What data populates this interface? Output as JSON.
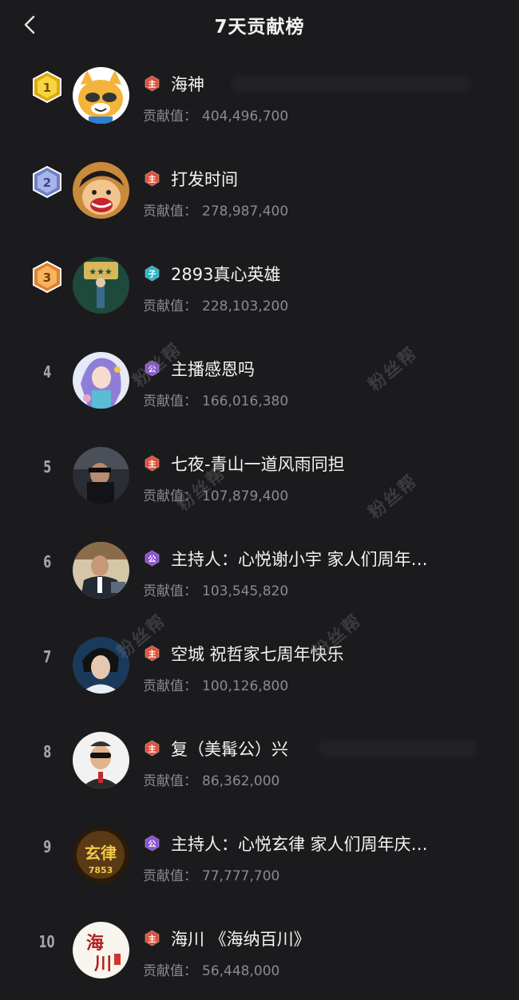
{
  "header": {
    "title": "7天贡献榜"
  },
  "contrib_label": "贡献值：",
  "watermark": "粉丝帮",
  "colors": {
    "badge_red": "#e0533a",
    "badge_cyan": "#2bb6c7",
    "badge_purple": "#8a52d6",
    "gold": "#f2c21c",
    "silver": "#8e9bd8",
    "bronze": "#f09a3a"
  },
  "entries": [
    {
      "rank": "1",
      "medal": "gold",
      "badge": "主",
      "badge_color": "red",
      "name": "海神",
      "value": "404,496,700",
      "avatar_icon": "raccoon-mascot-icon"
    },
    {
      "rank": "2",
      "medal": "silver",
      "badge": "主",
      "badge_color": "red",
      "name": "打发时间",
      "value": "278,987,400",
      "avatar_icon": "anime-boy-icon"
    },
    {
      "rank": "3",
      "medal": "bronze",
      "badge": "子",
      "badge_color": "cyan",
      "name": "2893真心英雄",
      "value": "228,103,200",
      "avatar_icon": "poster-icon"
    },
    {
      "rank": "4",
      "medal": "",
      "badge": "公",
      "badge_color": "purple",
      "name": "主播感恩吗",
      "value": "166,016,380",
      "avatar_icon": "anime-girl-icon"
    },
    {
      "rank": "5",
      "medal": "",
      "badge": "主",
      "badge_color": "red",
      "name": "七夜-青山一道风雨同担",
      "value": "107,879,400",
      "avatar_icon": "man-photo-icon"
    },
    {
      "rank": "6",
      "medal": "",
      "badge": "公",
      "badge_color": "purple",
      "name": "主持人：心悦谢小宇  家人们周年…",
      "value": "103,545,820",
      "avatar_icon": "man-suit-icon"
    },
    {
      "rank": "7",
      "medal": "",
      "badge": "主",
      "badge_color": "red",
      "name": "空城 祝哲家七周年快乐",
      "value": "100,126,800",
      "avatar_icon": "man-portrait-icon"
    },
    {
      "rank": "8",
      "medal": "",
      "badge": "主",
      "badge_color": "red",
      "name": "复（美髯公）兴",
      "value": "86,362,000",
      "avatar_icon": "cartoon-man-icon"
    },
    {
      "rank": "9",
      "medal": "",
      "badge": "公",
      "badge_color": "purple",
      "name": "主持人：心悦玄律  家人们周年庆…",
      "value": "77,777,700",
      "avatar_icon": "logo-badge-icon"
    },
    {
      "rank": "10",
      "medal": "",
      "badge": "主",
      "badge_color": "red",
      "name": "海川 《海纳百川》",
      "value": "56,448,000",
      "avatar_icon": "calligraphy-icon"
    }
  ]
}
